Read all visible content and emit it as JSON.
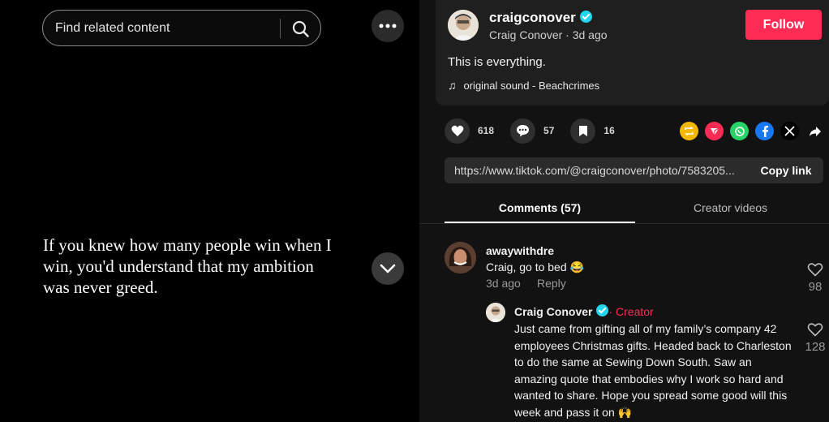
{
  "left": {
    "search": {
      "placeholder": "Find related content"
    },
    "quote": "If you knew how many people win when I win, you'd understand that my ambition was never greed."
  },
  "post": {
    "username": "craigconover",
    "display_name": "Craig Conover",
    "time_ago": "3d ago",
    "subline": "Craig Conover · 3d ago",
    "follow_label": "Follow",
    "caption": "This is everything.",
    "sound": "original sound - Beachcrimes"
  },
  "stats": {
    "likes": "618",
    "comments": "57",
    "saves": "16"
  },
  "share": {
    "url": "https://www.tiktok.com/@craigconover/photo/7583205...",
    "copy_label": "Copy link",
    "icons": [
      "repost-icon",
      "send-icon",
      "whatsapp-icon",
      "facebook-icon",
      "x-icon",
      "share-arrow-icon"
    ],
    "colors": {
      "repost": "#f5b800",
      "send": "#fe2c55",
      "whatsapp": "#25d366",
      "facebook": "#1877f2",
      "x": "#000000"
    }
  },
  "tabs": [
    {
      "label": "Comments (57)",
      "active": true
    },
    {
      "label": "Creator videos",
      "active": false
    }
  ],
  "comments": [
    {
      "username": "awaywithdre",
      "text": "Craig, go to bed 😂",
      "time": "3d ago",
      "reply_label": "Reply",
      "likes": "98"
    }
  ],
  "reply": {
    "username": "Craig Conover",
    "badge": "· Creator",
    "text": "Just came from gifting all of my family’s company 42 employees Christmas gifts. Headed back to Charleston to do the same at Sewing Down South. Saw an amazing quote that embodies why I work so hard and wanted to share. Hope you spread some good will this week and pass it on 🙌",
    "likes": "128"
  },
  "colors": {
    "accent": "#fe2c55",
    "verified": "#20d5ec"
  }
}
